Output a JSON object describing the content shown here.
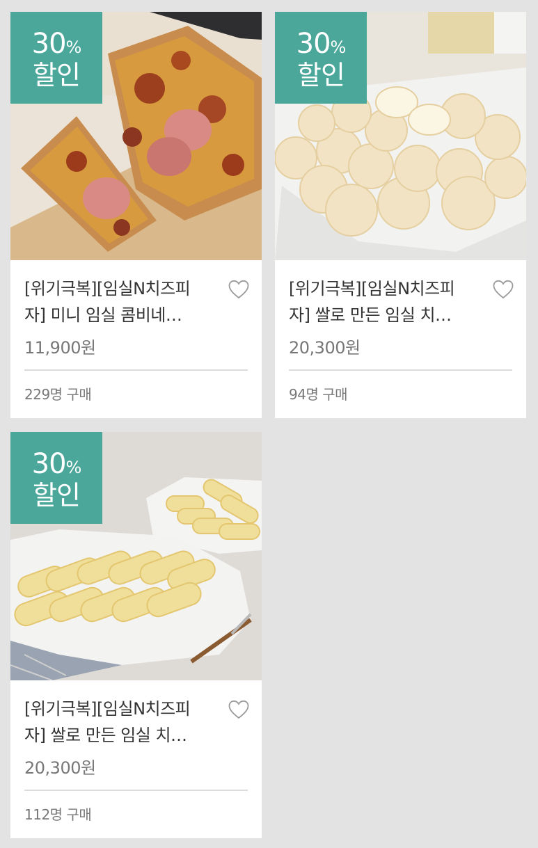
{
  "products": [
    {
      "badge_percent": "30",
      "badge_percent_sign": "%",
      "badge_text": "할인",
      "title_line1": "[위기극복][임실N치즈피",
      "title_line2": "자] 미니 임실 콤비네…",
      "price": "11,900원",
      "buyers": "229명 구매",
      "image": "pizza"
    },
    {
      "badge_percent": "30",
      "badge_percent_sign": "%",
      "badge_text": "할인",
      "title_line1": "[위기극복][임실N치즈피",
      "title_line2": "자] 쌀로 만든 임실 치…",
      "price": "20,300원",
      "buyers": "94명 구매",
      "image": "cheese-balls"
    },
    {
      "badge_percent": "30",
      "badge_percent_sign": "%",
      "badge_text": "할인",
      "title_line1": "[위기극복][임실N치즈피",
      "title_line2": "자] 쌀로 만든 임실 치…",
      "price": "20,300원",
      "buyers": "112명 구매",
      "image": "cheese-sticks"
    }
  ],
  "colors": {
    "badge": "#4aa79a",
    "background": "#e3e3e3",
    "card": "#ffffff"
  },
  "icons": {
    "wishlist": "heart-outline-icon"
  }
}
